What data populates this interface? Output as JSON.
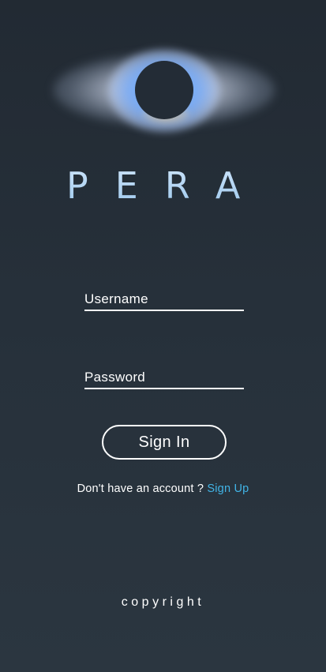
{
  "brand": {
    "name": "PERA",
    "logo_icon": "eclipse-icon"
  },
  "login": {
    "username_placeholder": "Username",
    "password_placeholder": "Password",
    "sign_in_label": "Sign In"
  },
  "signup": {
    "prompt": "Don't have an account ?",
    "link_label": "Sign Up"
  },
  "footer": {
    "copyright": "copyright"
  },
  "colors": {
    "background": "#252f39",
    "brand_text": "#a9d0f0",
    "link": "#41b4e6",
    "foreground": "#ffffff"
  }
}
